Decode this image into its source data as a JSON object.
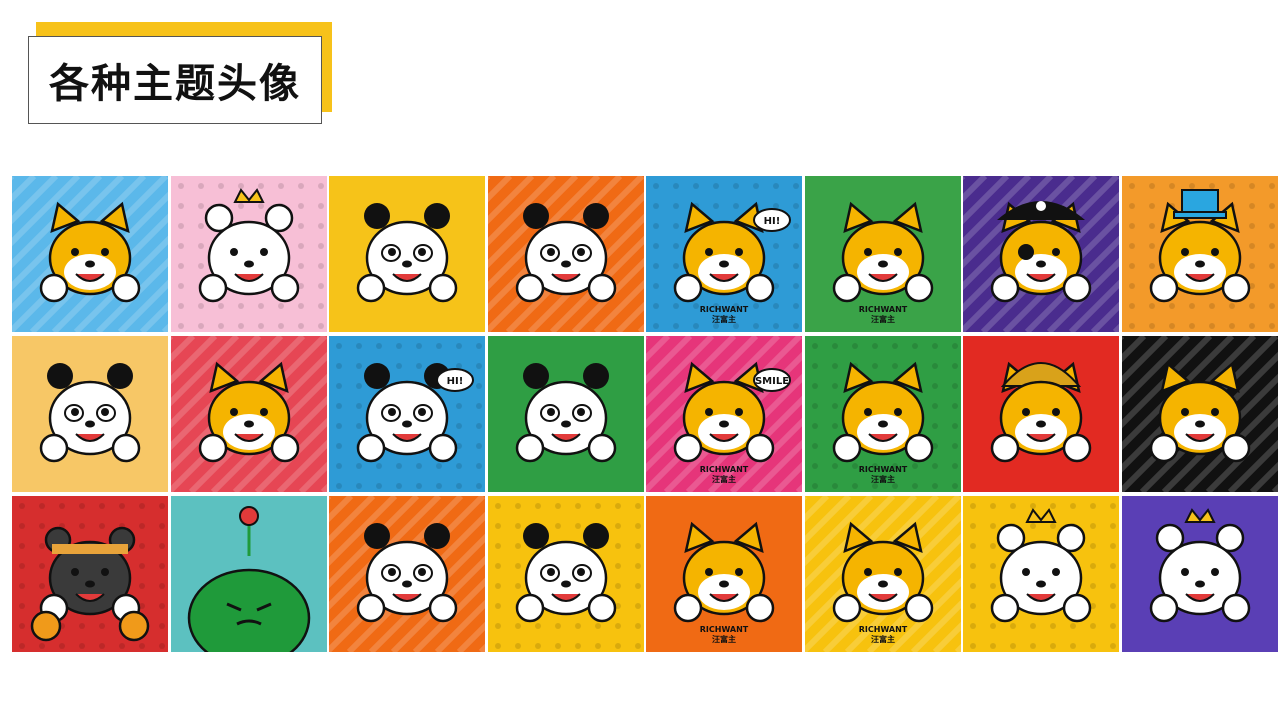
{
  "title": "各种主题头像",
  "colors": {
    "accent": "#f7c21a",
    "black": "#111111",
    "white": "#ffffff"
  },
  "tiles": [
    {
      "row": 0,
      "col": 0,
      "char": "shiba",
      "bg": "#5bb8ea",
      "body": "#f5b400",
      "label": ""
    },
    {
      "row": 0,
      "col": 1,
      "char": "bear",
      "bg": "#f7bfd6",
      "body": "#ffffff",
      "label": ""
    },
    {
      "row": 0,
      "col": 2,
      "char": "panda",
      "bg": "#f6c319",
      "body": "#ffffff",
      "label": ""
    },
    {
      "row": 0,
      "col": 3,
      "char": "panda",
      "bg": "#f06a14",
      "body": "#ffffff",
      "label": ""
    },
    {
      "row": 0,
      "col": 4,
      "char": "shiba",
      "bg": "#2e9bd6",
      "body": "#f5b400",
      "label": "RICHWANT\n汪富主",
      "bubble": "HI!"
    },
    {
      "row": 0,
      "col": 5,
      "char": "shiba",
      "bg": "#3aa348",
      "body": "#f5b400",
      "label": "RICHWANT\n汪富主"
    },
    {
      "row": 0,
      "col": 6,
      "char": "pirate",
      "bg": "#4a2c8e",
      "body": "#f5b400",
      "label": ""
    },
    {
      "row": 0,
      "col": 7,
      "char": "clown",
      "bg": "#f39a2a",
      "body": "#f5b400",
      "label": ""
    },
    {
      "row": 1,
      "col": 0,
      "char": "panda",
      "bg": "#f7c766",
      "body": "#ffffff",
      "label": ""
    },
    {
      "row": 1,
      "col": 1,
      "char": "tiger",
      "bg": "#e64654",
      "body": "#f5b400",
      "label": ""
    },
    {
      "row": 1,
      "col": 2,
      "char": "panda",
      "bg": "#2e9bd6",
      "body": "#ffffff",
      "label": "",
      "bubble": "HI!"
    },
    {
      "row": 1,
      "col": 3,
      "char": "panda",
      "bg": "#2f9e44",
      "body": "#ffffff",
      "label": ""
    },
    {
      "row": 1,
      "col": 4,
      "char": "shiba",
      "bg": "#e6357a",
      "body": "#f5b400",
      "label": "RICHWANT\n汪富主",
      "bubble": "SMILE"
    },
    {
      "row": 1,
      "col": 5,
      "char": "shiba",
      "bg": "#2f9e44",
      "body": "#f5b400",
      "label": "RICHWANT\n汪富主"
    },
    {
      "row": 1,
      "col": 6,
      "char": "samurai",
      "bg": "#e22a22",
      "body": "#f5b400",
      "label": ""
    },
    {
      "row": 1,
      "col": 7,
      "char": "shiba",
      "bg": "#111111",
      "body": "#f5b400",
      "label": ""
    },
    {
      "row": 2,
      "col": 0,
      "char": "boxer",
      "bg": "#d62e2e",
      "body": "#3a3a3a",
      "label": ""
    },
    {
      "row": 2,
      "col": 1,
      "char": "monster",
      "bg": "#5cc1c0",
      "body": "#1f9a3a",
      "label": ""
    },
    {
      "row": 2,
      "col": 2,
      "char": "panda",
      "bg": "#f06a14",
      "body": "#ffffff",
      "label": ""
    },
    {
      "row": 2,
      "col": 3,
      "char": "panda",
      "bg": "#f7c20e",
      "body": "#ffffff",
      "label": ""
    },
    {
      "row": 2,
      "col": 4,
      "char": "shiba",
      "bg": "#f06a14",
      "body": "#f5b400",
      "label": "RICHWANT\n汪富主"
    },
    {
      "row": 2,
      "col": 5,
      "char": "shiba",
      "bg": "#f7c20e",
      "body": "#f5b400",
      "label": "RICHWANT\n汪富主"
    },
    {
      "row": 2,
      "col": 6,
      "char": "bear",
      "bg": "#f7c20e",
      "body": "#ffffff",
      "label": ""
    },
    {
      "row": 2,
      "col": 7,
      "char": "bear",
      "bg": "#5a3fb5",
      "body": "#ffffff",
      "label": ""
    }
  ]
}
